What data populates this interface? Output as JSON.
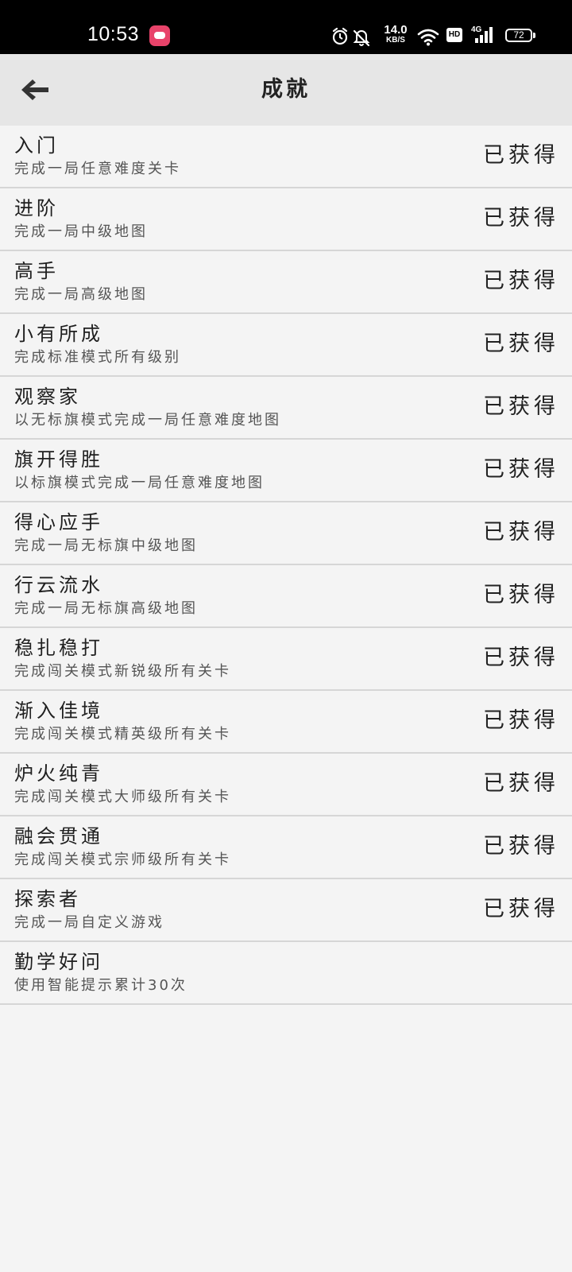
{
  "status_bar": {
    "time": "10:53",
    "net_speed_value": "14.0",
    "net_speed_unit": "KB/S",
    "hd_label": "HD",
    "network_type": "4G",
    "battery": "72"
  },
  "toolbar": {
    "title": "成就"
  },
  "achievements": [
    {
      "title": "入门",
      "desc": "完成一局任意难度关卡",
      "status": "已获得"
    },
    {
      "title": "进阶",
      "desc": "完成一局中级地图",
      "status": "已获得"
    },
    {
      "title": "高手",
      "desc": "完成一局高级地图",
      "status": "已获得"
    },
    {
      "title": "小有所成",
      "desc": "完成标准模式所有级别",
      "status": "已获得"
    },
    {
      "title": "观察家",
      "desc": "以无标旗模式完成一局任意难度地图",
      "status": "已获得"
    },
    {
      "title": "旗开得胜",
      "desc": "以标旗模式完成一局任意难度地图",
      "status": "已获得"
    },
    {
      "title": "得心应手",
      "desc": "完成一局无标旗中级地图",
      "status": "已获得"
    },
    {
      "title": "行云流水",
      "desc": "完成一局无标旗高级地图",
      "status": "已获得"
    },
    {
      "title": "稳扎稳打",
      "desc": "完成闯关模式新锐级所有关卡",
      "status": "已获得"
    },
    {
      "title": "渐入佳境",
      "desc": "完成闯关模式精英级所有关卡",
      "status": "已获得"
    },
    {
      "title": "炉火纯青",
      "desc": "完成闯关模式大师级所有关卡",
      "status": "已获得"
    },
    {
      "title": "融会贯通",
      "desc": "完成闯关模式宗师级所有关卡",
      "status": "已获得"
    },
    {
      "title": "探索者",
      "desc": "完成一局自定义游戏",
      "status": "已获得"
    },
    {
      "title": "勤学好问",
      "desc": "使用智能提示累计30次",
      "status": ""
    }
  ]
}
